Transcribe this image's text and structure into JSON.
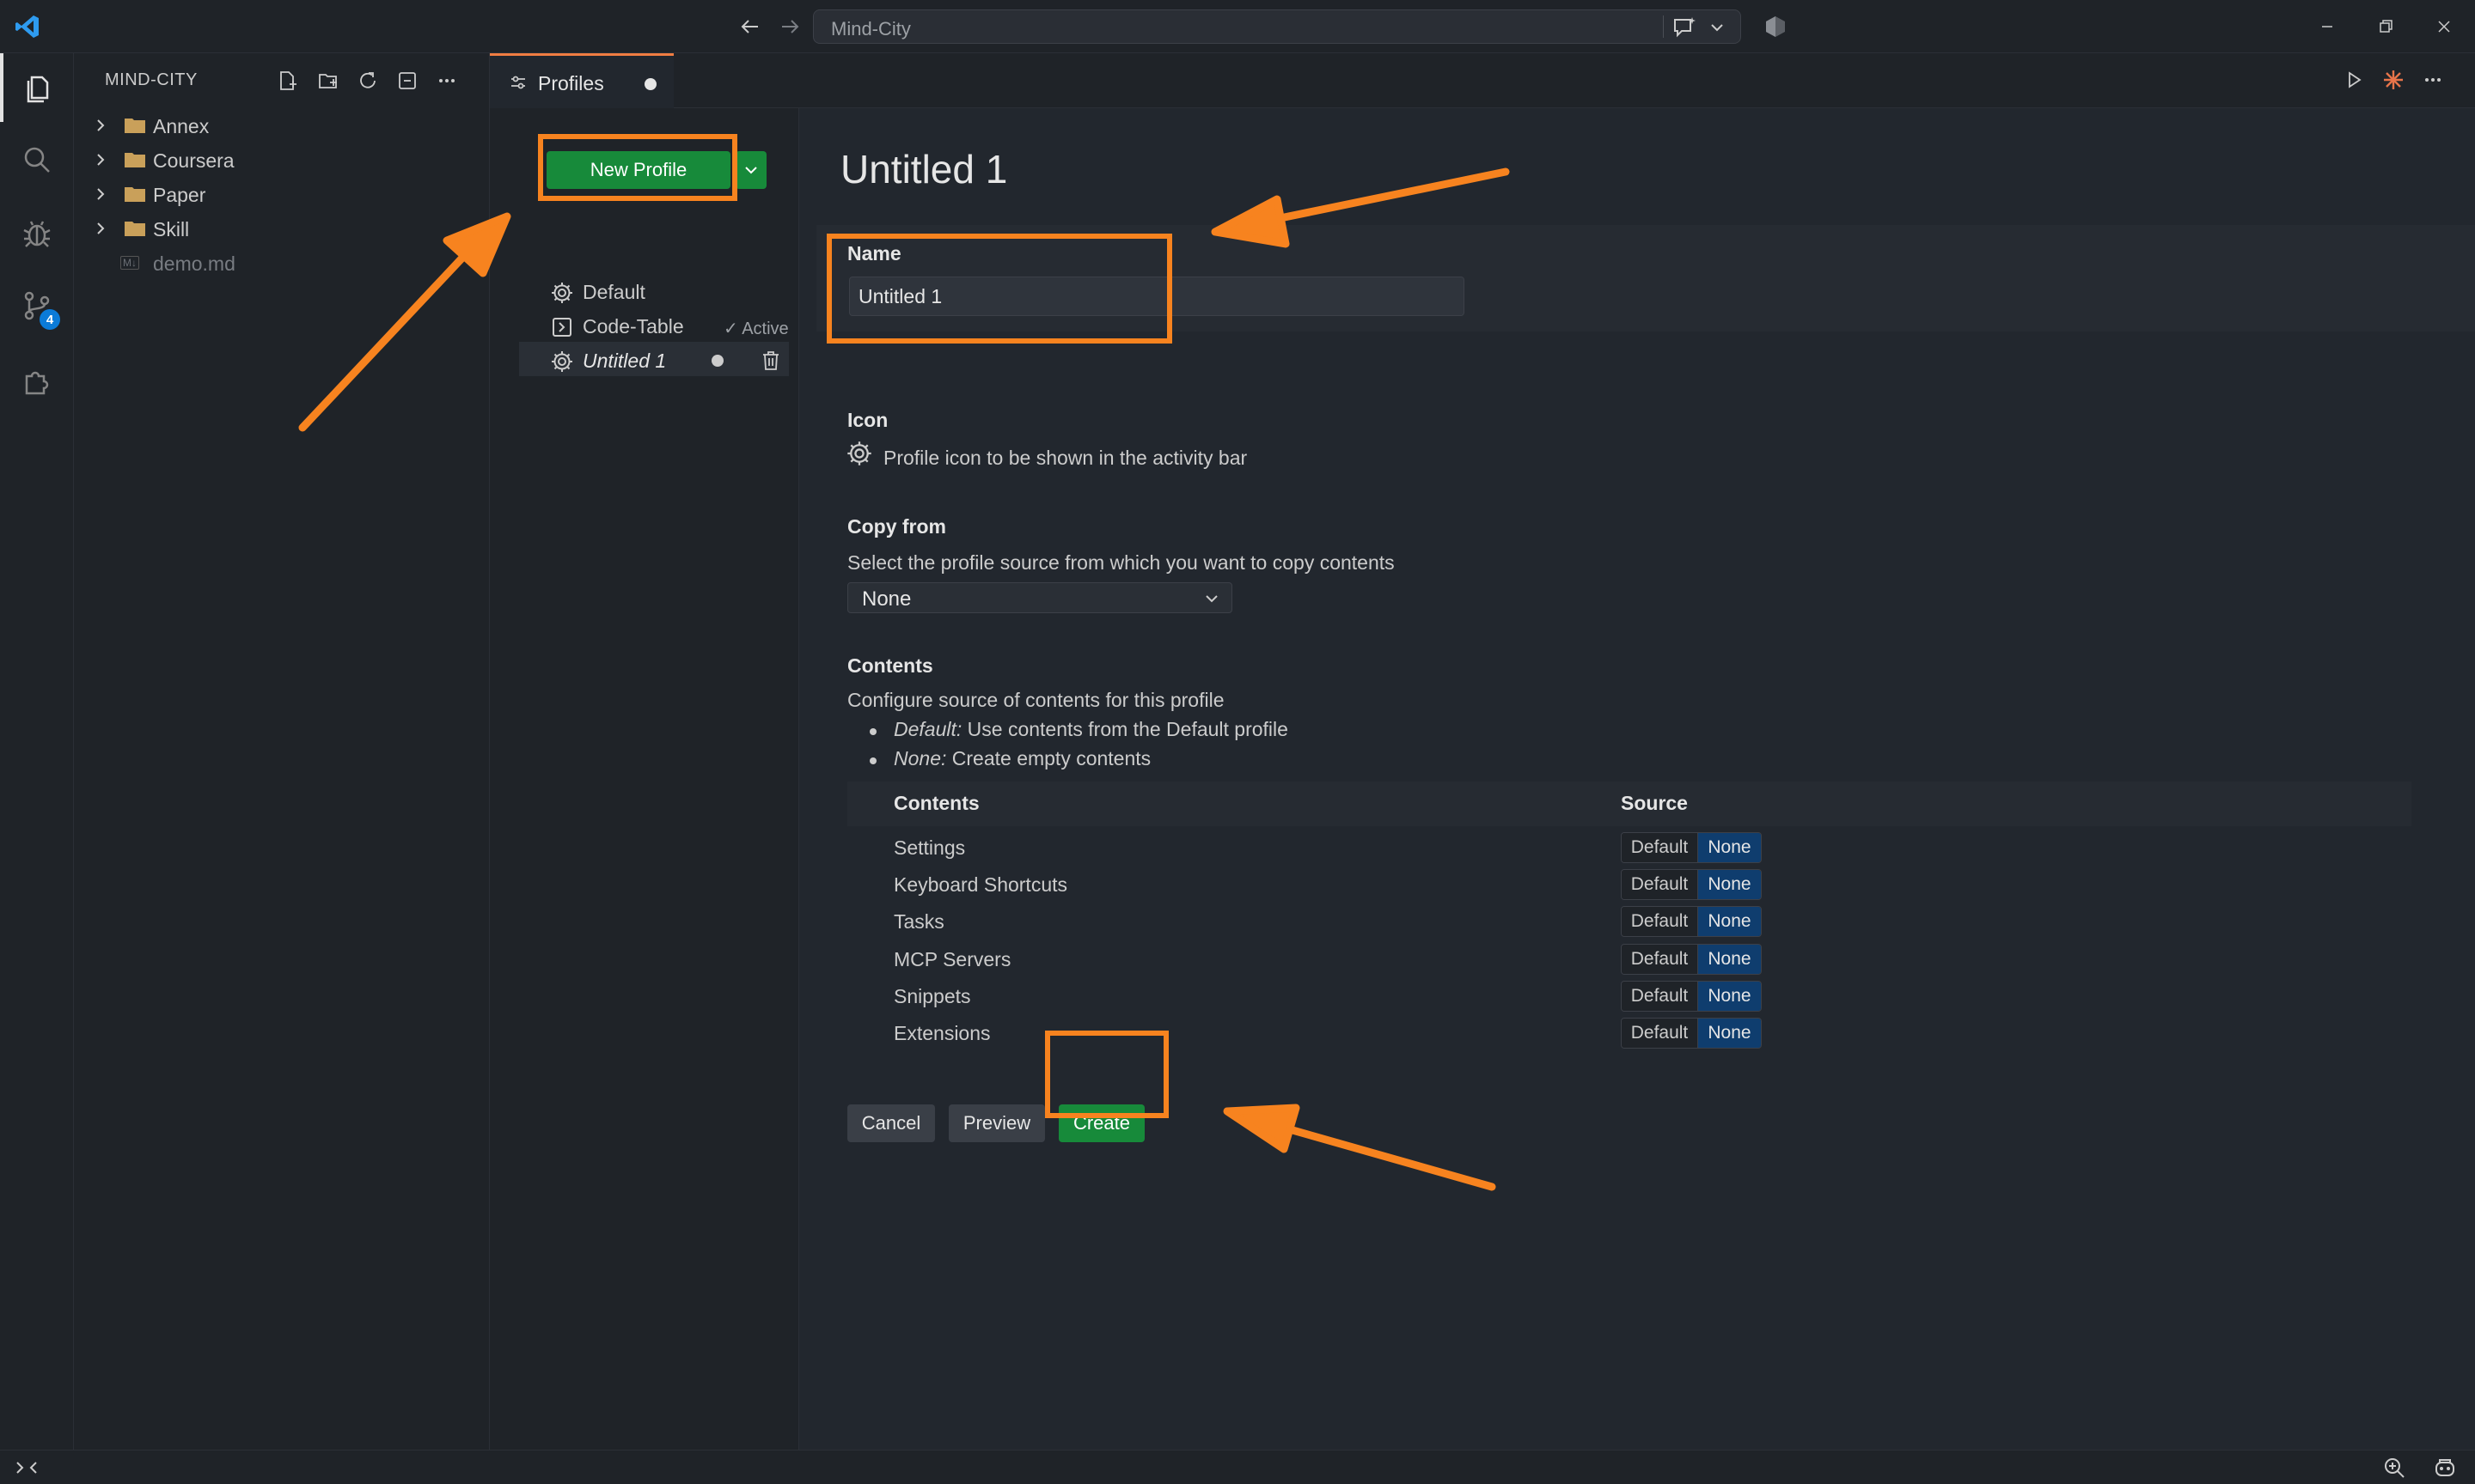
{
  "titlebar": {
    "search_text": "Mind-City"
  },
  "activity_bar": {
    "scm_badge": "4"
  },
  "sidebar": {
    "title": "MIND-CITY",
    "tree": [
      {
        "label": "Annex",
        "type": "folder"
      },
      {
        "label": "Coursera",
        "type": "folder"
      },
      {
        "label": "Paper",
        "type": "folder"
      },
      {
        "label": "Skill",
        "type": "folder"
      },
      {
        "label": "demo.md",
        "type": "file",
        "badge": "M↓"
      }
    ]
  },
  "editor": {
    "tab_label": "Profiles"
  },
  "profiles": {
    "new_button": "New Profile",
    "list": [
      {
        "label": "Default",
        "icon": "gear-icon"
      },
      {
        "label": "Code-Table",
        "icon": "terminal-icon",
        "tag": "✓ Active"
      },
      {
        "label": "Untitled 1",
        "icon": "gear-icon"
      }
    ]
  },
  "detail": {
    "title": "Untitled 1",
    "name_label": "Name",
    "name_value": "Untitled 1",
    "icon_label": "Icon",
    "icon_desc": "Profile icon to be shown in the activity bar",
    "copy_label": "Copy from",
    "copy_desc": "Select the profile source from which you want to copy contents",
    "copy_value": "None",
    "contents_label": "Contents",
    "contents_desc": "Configure source of contents for this profile",
    "bullets": [
      {
        "term": "Default:",
        "text": " Use contents from the Default profile"
      },
      {
        "term": "None:",
        "text": " Create empty contents"
      }
    ],
    "table_head_contents": "Contents",
    "table_head_source": "Source",
    "rows": [
      {
        "name": "Settings",
        "default": "Default",
        "none": "None"
      },
      {
        "name": "Keyboard Shortcuts",
        "default": "Default",
        "none": "None"
      },
      {
        "name": "Tasks",
        "default": "Default",
        "none": "None"
      },
      {
        "name": "MCP Servers",
        "default": "Default",
        "none": "None"
      },
      {
        "name": "Snippets",
        "default": "Default",
        "none": "None"
      },
      {
        "name": "Extensions",
        "default": "Default",
        "none": "None"
      }
    ],
    "cancel": "Cancel",
    "preview": "Preview",
    "create": "Create"
  },
  "colors": {
    "accent_green": "#178a3a",
    "annotation_orange": "#f7831f",
    "none_selected": "#0f3d6e",
    "tab_accent": "#f17d42"
  }
}
